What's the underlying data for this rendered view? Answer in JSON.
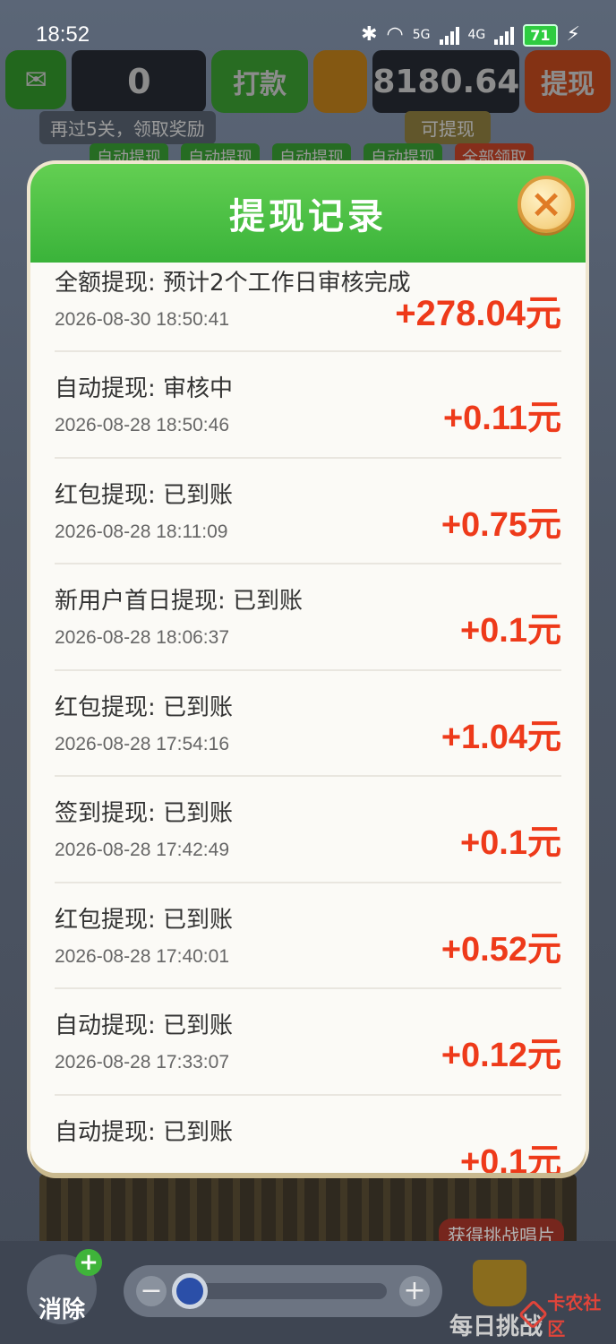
{
  "status_bar": {
    "time": "18:52",
    "network_5g": "5G",
    "network_4g": "4G",
    "battery": "71"
  },
  "background": {
    "wechat_count": "0",
    "pay_button": "打款",
    "balance": "8180.64",
    "withdraw_button": "提现",
    "hint": "再过5关，领取奖励",
    "withdrawable": "可提现",
    "chips": [
      "自动提现",
      "自动提现",
      "自动提现",
      "自动提现",
      "全部领取"
    ],
    "challenge_banner": "获得挑战唱片",
    "eliminate_label": "消除",
    "daily_challenge": "每日挑战",
    "watermark": "卡农社区"
  },
  "modal": {
    "title": "提现记录",
    "close_label": "×",
    "records": [
      {
        "title": "全额提现: 预计2个工作日审核完成",
        "date": "2026-08-30 18:50:41",
        "amount": "+278.04元"
      },
      {
        "title": "自动提现: 审核中",
        "date": "2026-08-28 18:50:46",
        "amount": "+0.11元"
      },
      {
        "title": "红包提现: 已到账",
        "date": "2026-08-28 18:11:09",
        "amount": "+0.75元"
      },
      {
        "title": "新用户首日提现: 已到账",
        "date": "2026-08-28 18:06:37",
        "amount": "+0.1元"
      },
      {
        "title": "红包提现: 已到账",
        "date": "2026-08-28 17:54:16",
        "amount": "+1.04元"
      },
      {
        "title": "签到提现: 已到账",
        "date": "2026-08-28 17:42:49",
        "amount": "+0.1元"
      },
      {
        "title": "红包提现: 已到账",
        "date": "2026-08-28 17:40:01",
        "amount": "+0.52元"
      },
      {
        "title": "自动提现: 已到账",
        "date": "2026-08-28 17:33:07",
        "amount": "+0.12元"
      },
      {
        "title": "自动提现: 已到账",
        "date": "",
        "amount": "+0.1元"
      }
    ]
  },
  "colors": {
    "header_green": "#3ab33a",
    "amount_red": "#ee3a1a",
    "close_gold": "#f6d487"
  }
}
